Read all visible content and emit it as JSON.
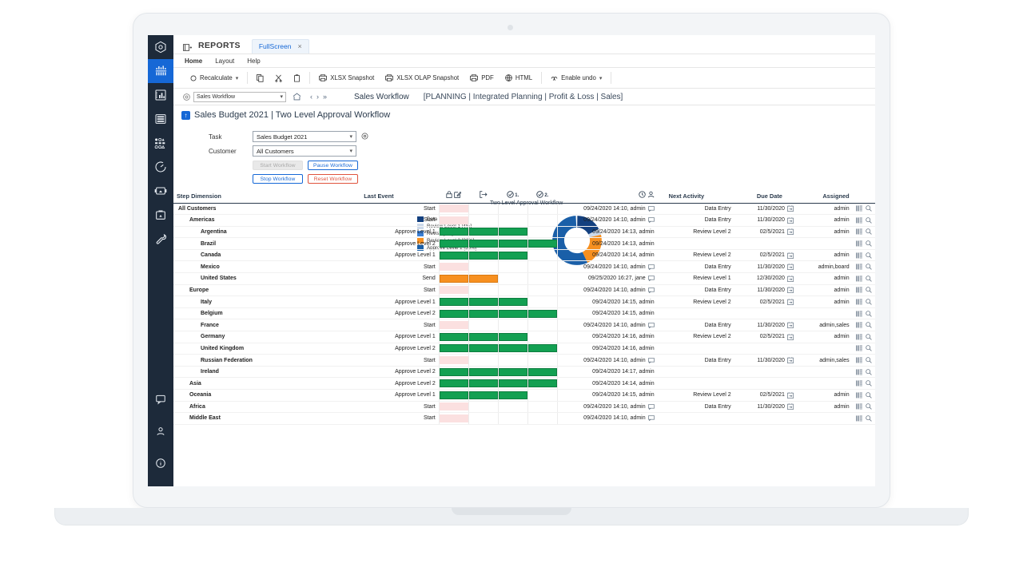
{
  "app": {
    "tabstrip": {
      "reports_label": "REPORTS",
      "tab_label": "FullScreen",
      "close_glyph": "×"
    },
    "menu": [
      "Home",
      "Layout",
      "Help"
    ],
    "ribbon": {
      "recalculate": "Recalculate",
      "xlsx_snapshot": "XLSX Snapshot",
      "xlsx_olap_snapshot": "XLSX OLAP Snapshot",
      "pdf": "PDF",
      "html": "HTML",
      "enable_undo": "Enable undo"
    },
    "navbar": {
      "selector_value": "Sales Workflow",
      "breadcrumb_title": "Sales Workflow",
      "breadcrumb_path": "[PLANNING | Integrated Planning | Profit & Loss | Sales]"
    },
    "report_title": "Sales Budget 2021 | Two Level Approval Workflow"
  },
  "rail": [
    {
      "name": "hexagon-logo-icon",
      "active": false
    },
    {
      "name": "analytics-icon",
      "active": true
    },
    {
      "name": "bar-chart-icon",
      "active": false
    },
    {
      "name": "database-icon",
      "active": false
    },
    {
      "name": "modeling-icon",
      "active": false
    },
    {
      "name": "clock-gauge-icon",
      "active": false
    },
    {
      "name": "presentation-icon",
      "active": false
    },
    {
      "name": "briefcase-icon",
      "active": false
    },
    {
      "name": "wrench-icon",
      "active": false
    }
  ],
  "rail_bottom": [
    {
      "name": "chat-icon"
    },
    {
      "name": "user-icon"
    },
    {
      "name": "info-icon"
    }
  ],
  "form": {
    "task_label": "Task",
    "task_value": "Sales Budget 2021",
    "customer_label": "Customer",
    "customer_value": "All Customers",
    "buttons": [
      {
        "label": "Start Workflow",
        "style": "disabled"
      },
      {
        "label": "Pause Workflow",
        "style": "blue"
      },
      {
        "label": "Stop Workflow",
        "style": "blue"
      },
      {
        "label": "Reset Workflow",
        "style": "red"
      }
    ]
  },
  "chart_data": {
    "type": "pie",
    "title": "Two Level Approval Workflow",
    "categories": [
      "Data Entry",
      "Review Level 1",
      "Revise",
      "Review Level 2",
      "Approve Level 2"
    ],
    "values": [
      17,
      4,
      0,
      22,
      56
    ],
    "colors": [
      "#13407f",
      "#ccd9ea",
      "#3b7fd4",
      "#f79020",
      "#1a5fa8"
    ],
    "legend_labels": [
      "Data Entry [17%]",
      "Review Level 1 [4%]",
      "Revise [0%]",
      "Review Level 2 [22%]",
      "Approve Level 2 [56%]"
    ],
    "legend_position": "left",
    "donut": true
  },
  "table": {
    "headers": {
      "step_dimension": "Step Dimension",
      "last_event": "Last Event",
      "lock_edit": "",
      "exit": "",
      "check1": "1.",
      "check2": "2.",
      "time_user": "",
      "next_activity": "Next Activity",
      "due_date": "Due Date",
      "assigned": "Assigned"
    },
    "rows": [
      {
        "dimension": "All Customers",
        "indent": 0,
        "last_event": "Start",
        "cells": [
          "pink",
          "",
          "",
          ""
        ],
        "timestamp": "09/24/2020 14:10, admin",
        "comment": true,
        "next_activity": "Data Entry",
        "due_date": "11/30/2020",
        "due_icon": true,
        "assigned": "admin"
      },
      {
        "dimension": "Americas",
        "indent": 1,
        "last_event": "Start",
        "cells": [
          "pink",
          "",
          "",
          ""
        ],
        "timestamp": "09/24/2020 14:10, admin",
        "comment": true,
        "next_activity": "Data Entry",
        "due_date": "11/30/2020",
        "due_icon": true,
        "assigned": "admin"
      },
      {
        "dimension": "Argentina",
        "indent": 2,
        "last_event": "Approve Level 1",
        "cells": [
          "green",
          "green",
          "green",
          ""
        ],
        "timestamp": "09/24/2020 14:13, admin",
        "comment": false,
        "next_activity": "Review Level 2",
        "due_date": "02/5/2021",
        "due_icon": true,
        "assigned": "admin"
      },
      {
        "dimension": "Brazil",
        "indent": 2,
        "last_event": "Approve Level 2",
        "cells": [
          "green",
          "green",
          "green",
          "green"
        ],
        "timestamp": "09/24/2020 14:13, admin",
        "comment": false,
        "next_activity": "",
        "due_date": "",
        "due_icon": false,
        "assigned": ""
      },
      {
        "dimension": "Canada",
        "indent": 2,
        "last_event": "Approve Level 1",
        "cells": [
          "green",
          "green",
          "green",
          ""
        ],
        "timestamp": "09/24/2020 14:14, admin",
        "comment": false,
        "next_activity": "Review Level 2",
        "due_date": "02/5/2021",
        "due_icon": true,
        "assigned": "admin"
      },
      {
        "dimension": "Mexico",
        "indent": 2,
        "last_event": "Start",
        "cells": [
          "pink",
          "",
          "",
          ""
        ],
        "timestamp": "09/24/2020 14:10, admin",
        "comment": true,
        "next_activity": "Data Entry",
        "due_date": "11/30/2020",
        "due_icon": true,
        "assigned": "admin,board"
      },
      {
        "dimension": "United States",
        "indent": 2,
        "last_event": "Send",
        "cells": [
          "orange",
          "orange",
          "",
          ""
        ],
        "timestamp": "09/25/2020 16:27, jane",
        "comment": true,
        "next_activity": "Review Level 1",
        "due_date": "12/30/2020",
        "due_icon": true,
        "assigned": "admin"
      },
      {
        "dimension": "Europe",
        "indent": 1,
        "last_event": "Start",
        "cells": [
          "pink",
          "",
          "",
          ""
        ],
        "timestamp": "09/24/2020 14:10, admin",
        "comment": true,
        "next_activity": "Data Entry",
        "due_date": "11/30/2020",
        "due_icon": true,
        "assigned": "admin"
      },
      {
        "dimension": "Italy",
        "indent": 2,
        "last_event": "Approve Level 1",
        "cells": [
          "green",
          "green",
          "green",
          ""
        ],
        "timestamp": "09/24/2020 14:15, admin",
        "comment": false,
        "next_activity": "Review Level 2",
        "due_date": "02/5/2021",
        "due_icon": true,
        "assigned": "admin"
      },
      {
        "dimension": "Belgium",
        "indent": 2,
        "last_event": "Approve Level 2",
        "cells": [
          "green",
          "green",
          "green",
          "green"
        ],
        "timestamp": "09/24/2020 14:15, admin",
        "comment": false,
        "next_activity": "",
        "due_date": "",
        "due_icon": false,
        "assigned": ""
      },
      {
        "dimension": "France",
        "indent": 2,
        "last_event": "Start",
        "cells": [
          "pink",
          "",
          "",
          ""
        ],
        "timestamp": "09/24/2020 14:10, admin",
        "comment": true,
        "next_activity": "Data Entry",
        "due_date": "11/30/2020",
        "due_icon": true,
        "assigned": "admin,sales"
      },
      {
        "dimension": "Germany",
        "indent": 2,
        "last_event": "Approve Level 1",
        "cells": [
          "green",
          "green",
          "green",
          ""
        ],
        "timestamp": "09/24/2020 14:16, admin",
        "comment": false,
        "next_activity": "Review Level 2",
        "due_date": "02/5/2021",
        "due_icon": true,
        "assigned": "admin"
      },
      {
        "dimension": "United Kingdom",
        "indent": 2,
        "last_event": "Approve Level 2",
        "cells": [
          "green",
          "green",
          "green",
          "green"
        ],
        "timestamp": "09/24/2020 14:16, admin",
        "comment": false,
        "next_activity": "",
        "due_date": "",
        "due_icon": false,
        "assigned": ""
      },
      {
        "dimension": "Russian Federation",
        "indent": 2,
        "last_event": "Start",
        "cells": [
          "pink",
          "",
          "",
          ""
        ],
        "timestamp": "09/24/2020 14:10, admin",
        "comment": true,
        "next_activity": "Data Entry",
        "due_date": "11/30/2020",
        "due_icon": true,
        "assigned": "admin,sales"
      },
      {
        "dimension": "Ireland",
        "indent": 2,
        "last_event": "Approve Level 2",
        "cells": [
          "green",
          "green",
          "green",
          "green"
        ],
        "timestamp": "09/24/2020 14:17, admin",
        "comment": false,
        "next_activity": "",
        "due_date": "",
        "due_icon": false,
        "assigned": ""
      },
      {
        "dimension": "Asia",
        "indent": 1,
        "last_event": "Approve Level 2",
        "cells": [
          "green",
          "green",
          "green",
          "green"
        ],
        "timestamp": "09/24/2020 14:14, admin",
        "comment": false,
        "next_activity": "",
        "due_date": "",
        "due_icon": false,
        "assigned": ""
      },
      {
        "dimension": "Oceania",
        "indent": 1,
        "last_event": "Approve Level 1",
        "cells": [
          "green",
          "green",
          "green",
          ""
        ],
        "timestamp": "09/24/2020 14:15, admin",
        "comment": false,
        "next_activity": "Review Level 2",
        "due_date": "02/5/2021",
        "due_icon": true,
        "assigned": "admin"
      },
      {
        "dimension": "Africa",
        "indent": 1,
        "last_event": "Start",
        "cells": [
          "pink",
          "",
          "",
          ""
        ],
        "timestamp": "09/24/2020 14:10, admin",
        "comment": true,
        "next_activity": "Data Entry",
        "due_date": "11/30/2020",
        "due_icon": true,
        "assigned": "admin"
      },
      {
        "dimension": "Middle East",
        "indent": 1,
        "last_event": "Start",
        "cells": [
          "pink",
          "",
          "",
          ""
        ],
        "timestamp": "09/24/2020 14:10, admin",
        "comment": true,
        "next_activity": "",
        "due_date": "",
        "due_icon": false,
        "assigned": ""
      }
    ]
  }
}
